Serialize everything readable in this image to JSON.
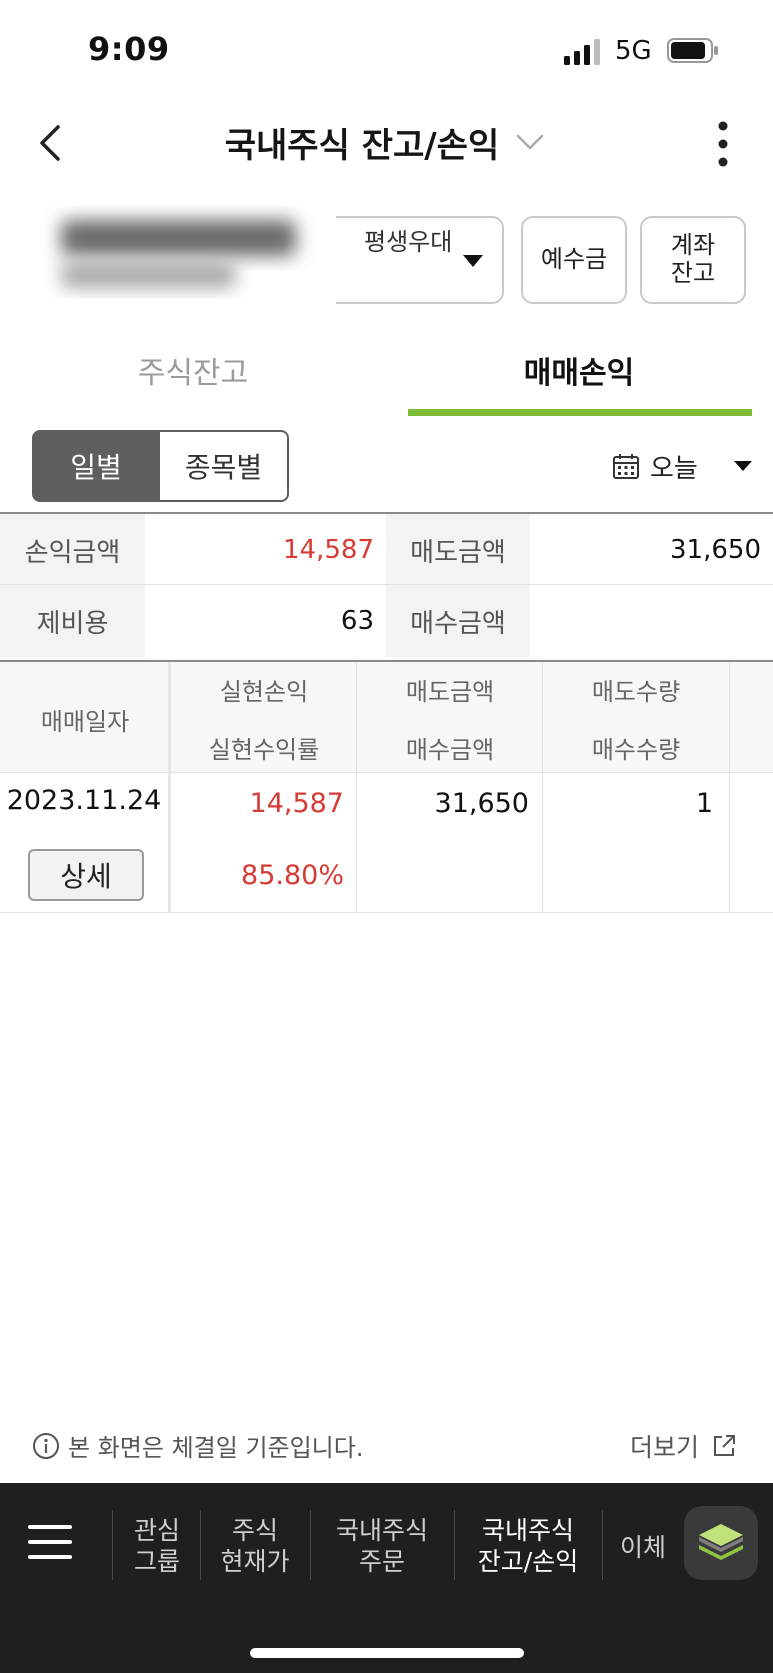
{
  "status": {
    "time": "9:09",
    "network": "5G"
  },
  "header": {
    "title": "국내주식 잔고/손익"
  },
  "account": {
    "name": "평생우대",
    "deposit_label": "예수금",
    "balance_label_line1": "계좌",
    "balance_label_line2": "잔고"
  },
  "tabs": [
    {
      "label": "주식잔고",
      "active": false
    },
    {
      "label": "매매손익",
      "active": true
    }
  ],
  "segmented": {
    "daily": "일별",
    "by_stock": "종목별"
  },
  "date_filter": {
    "label": "오늘"
  },
  "summary": {
    "pl_amount_label": "손익금액",
    "pl_amount": "14,587",
    "sell_amount_label": "매도금액",
    "sell_amount": "31,650",
    "fees_label": "제비용",
    "fees": "63",
    "buy_amount_label": "매수금액",
    "buy_amount": ""
  },
  "table": {
    "headers": {
      "trade_date": "매매일자",
      "realized_pl": "실현손익",
      "realized_rate": "실현수익률",
      "sell_amount": "매도금액",
      "buy_amount": "매수금액",
      "sell_qty": "매도수량",
      "buy_qty": "매수수량"
    },
    "rows": [
      {
        "date": "2023.11.24",
        "realized_pl": "14,587",
        "realized_rate": "85.80%",
        "sell_amount": "31,650",
        "buy_amount": "",
        "sell_qty": "1",
        "buy_qty": "",
        "detail_label": "상세"
      }
    ]
  },
  "footer": {
    "note": "본 화면은 체결일 기준입니다.",
    "more": "더보기"
  },
  "bottom_nav": {
    "items": [
      {
        "line1": "관심",
        "line2": "그룹"
      },
      {
        "line1": "주식",
        "line2": "현재가"
      },
      {
        "line1": "국내주식",
        "line2": "주문"
      },
      {
        "line1": "국내주식",
        "line2": "잔고/손익"
      },
      {
        "line1": "이체",
        "line2": ""
      }
    ]
  },
  "colors": {
    "accent": "#7dbd36",
    "profit": "#d63b34",
    "nav_bg": "#1f1f1f"
  }
}
